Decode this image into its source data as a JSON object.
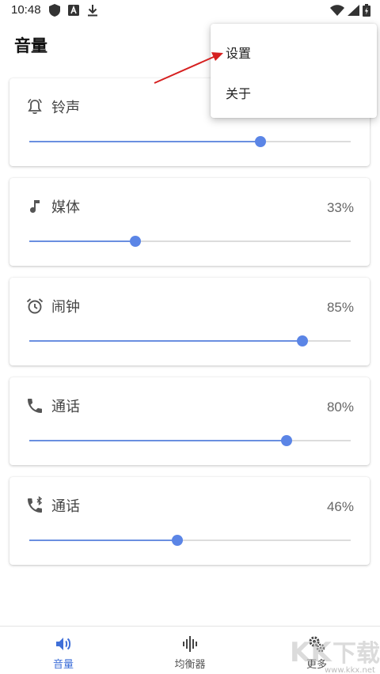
{
  "status_bar": {
    "time": "10:48",
    "left_icons": [
      "shield-icon",
      "a-box-icon",
      "download-icon"
    ],
    "right_icons": [
      "wifi-icon",
      "signal-icon",
      "battery-charging-icon"
    ]
  },
  "header": {
    "title": "音量"
  },
  "cards": [
    {
      "label": "铃声",
      "icon": "bell-icon",
      "percent": "",
      "level": 0.72
    },
    {
      "label": "媒体",
      "icon": "music-note-icon",
      "percent": "33%",
      "level": 0.33
    },
    {
      "label": "闹钟",
      "icon": "alarm-clock-icon",
      "percent": "85%",
      "level": 0.85
    },
    {
      "label": "通话",
      "icon": "phone-icon",
      "percent": "80%",
      "level": 0.8
    },
    {
      "label": "通话",
      "icon": "bluetooth-phone-icon",
      "percent": "46%",
      "level": 0.46
    }
  ],
  "overflow_menu": {
    "items": [
      {
        "label": "设置"
      },
      {
        "label": "关于"
      }
    ]
  },
  "bottom_nav": {
    "items": [
      {
        "label": "音量",
        "icon": "volume-icon",
        "active": true
      },
      {
        "label": "均衡器",
        "icon": "equalizer-icon",
        "active": false
      },
      {
        "label": "更多",
        "icon": "gears-icon",
        "active": false
      }
    ]
  },
  "watermark": {
    "text": "KK下载",
    "url": "www.kkx.net"
  },
  "colors": {
    "accent": "#5b85e6",
    "track": "#dcdcdc",
    "annotation_arrow": "#d62020",
    "active_nav": "#3f6fd8"
  }
}
